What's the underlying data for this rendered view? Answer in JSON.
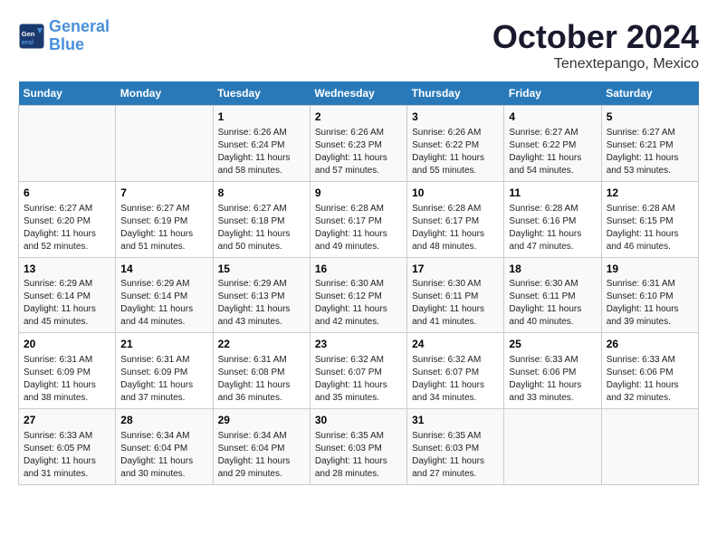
{
  "header": {
    "logo_line1": "General",
    "logo_line2": "Blue",
    "month": "October 2024",
    "location": "Tenextepango, Mexico"
  },
  "days_of_week": [
    "Sunday",
    "Monday",
    "Tuesday",
    "Wednesday",
    "Thursday",
    "Friday",
    "Saturday"
  ],
  "weeks": [
    [
      {
        "day": "",
        "text": ""
      },
      {
        "day": "",
        "text": ""
      },
      {
        "day": "1",
        "text": "Sunrise: 6:26 AM\nSunset: 6:24 PM\nDaylight: 11 hours and 58 minutes."
      },
      {
        "day": "2",
        "text": "Sunrise: 6:26 AM\nSunset: 6:23 PM\nDaylight: 11 hours and 57 minutes."
      },
      {
        "day": "3",
        "text": "Sunrise: 6:26 AM\nSunset: 6:22 PM\nDaylight: 11 hours and 55 minutes."
      },
      {
        "day": "4",
        "text": "Sunrise: 6:27 AM\nSunset: 6:22 PM\nDaylight: 11 hours and 54 minutes."
      },
      {
        "day": "5",
        "text": "Sunrise: 6:27 AM\nSunset: 6:21 PM\nDaylight: 11 hours and 53 minutes."
      }
    ],
    [
      {
        "day": "6",
        "text": "Sunrise: 6:27 AM\nSunset: 6:20 PM\nDaylight: 11 hours and 52 minutes."
      },
      {
        "day": "7",
        "text": "Sunrise: 6:27 AM\nSunset: 6:19 PM\nDaylight: 11 hours and 51 minutes."
      },
      {
        "day": "8",
        "text": "Sunrise: 6:27 AM\nSunset: 6:18 PM\nDaylight: 11 hours and 50 minutes."
      },
      {
        "day": "9",
        "text": "Sunrise: 6:28 AM\nSunset: 6:17 PM\nDaylight: 11 hours and 49 minutes."
      },
      {
        "day": "10",
        "text": "Sunrise: 6:28 AM\nSunset: 6:17 PM\nDaylight: 11 hours and 48 minutes."
      },
      {
        "day": "11",
        "text": "Sunrise: 6:28 AM\nSunset: 6:16 PM\nDaylight: 11 hours and 47 minutes."
      },
      {
        "day": "12",
        "text": "Sunrise: 6:28 AM\nSunset: 6:15 PM\nDaylight: 11 hours and 46 minutes."
      }
    ],
    [
      {
        "day": "13",
        "text": "Sunrise: 6:29 AM\nSunset: 6:14 PM\nDaylight: 11 hours and 45 minutes."
      },
      {
        "day": "14",
        "text": "Sunrise: 6:29 AM\nSunset: 6:14 PM\nDaylight: 11 hours and 44 minutes."
      },
      {
        "day": "15",
        "text": "Sunrise: 6:29 AM\nSunset: 6:13 PM\nDaylight: 11 hours and 43 minutes."
      },
      {
        "day": "16",
        "text": "Sunrise: 6:30 AM\nSunset: 6:12 PM\nDaylight: 11 hours and 42 minutes."
      },
      {
        "day": "17",
        "text": "Sunrise: 6:30 AM\nSunset: 6:11 PM\nDaylight: 11 hours and 41 minutes."
      },
      {
        "day": "18",
        "text": "Sunrise: 6:30 AM\nSunset: 6:11 PM\nDaylight: 11 hours and 40 minutes."
      },
      {
        "day": "19",
        "text": "Sunrise: 6:31 AM\nSunset: 6:10 PM\nDaylight: 11 hours and 39 minutes."
      }
    ],
    [
      {
        "day": "20",
        "text": "Sunrise: 6:31 AM\nSunset: 6:09 PM\nDaylight: 11 hours and 38 minutes."
      },
      {
        "day": "21",
        "text": "Sunrise: 6:31 AM\nSunset: 6:09 PM\nDaylight: 11 hours and 37 minutes."
      },
      {
        "day": "22",
        "text": "Sunrise: 6:31 AM\nSunset: 6:08 PM\nDaylight: 11 hours and 36 minutes."
      },
      {
        "day": "23",
        "text": "Sunrise: 6:32 AM\nSunset: 6:07 PM\nDaylight: 11 hours and 35 minutes."
      },
      {
        "day": "24",
        "text": "Sunrise: 6:32 AM\nSunset: 6:07 PM\nDaylight: 11 hours and 34 minutes."
      },
      {
        "day": "25",
        "text": "Sunrise: 6:33 AM\nSunset: 6:06 PM\nDaylight: 11 hours and 33 minutes."
      },
      {
        "day": "26",
        "text": "Sunrise: 6:33 AM\nSunset: 6:06 PM\nDaylight: 11 hours and 32 minutes."
      }
    ],
    [
      {
        "day": "27",
        "text": "Sunrise: 6:33 AM\nSunset: 6:05 PM\nDaylight: 11 hours and 31 minutes."
      },
      {
        "day": "28",
        "text": "Sunrise: 6:34 AM\nSunset: 6:04 PM\nDaylight: 11 hours and 30 minutes."
      },
      {
        "day": "29",
        "text": "Sunrise: 6:34 AM\nSunset: 6:04 PM\nDaylight: 11 hours and 29 minutes."
      },
      {
        "day": "30",
        "text": "Sunrise: 6:35 AM\nSunset: 6:03 PM\nDaylight: 11 hours and 28 minutes."
      },
      {
        "day": "31",
        "text": "Sunrise: 6:35 AM\nSunset: 6:03 PM\nDaylight: 11 hours and 27 minutes."
      },
      {
        "day": "",
        "text": ""
      },
      {
        "day": "",
        "text": ""
      }
    ]
  ]
}
